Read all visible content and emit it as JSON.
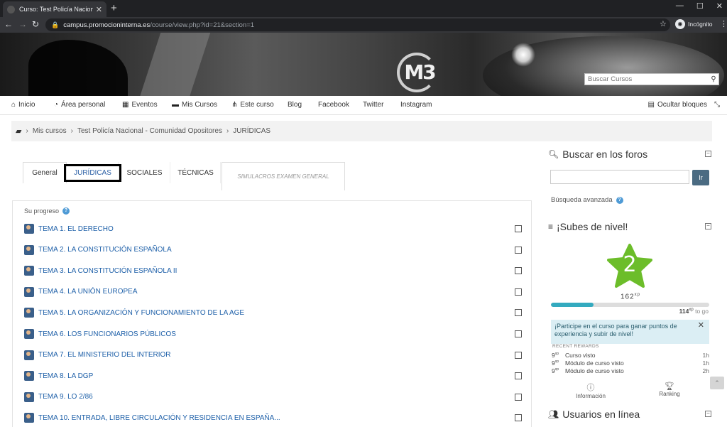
{
  "browser": {
    "tab_title": "Curso: Test Policía Nacional - Co",
    "url_host": "campus.promocioninterna.es",
    "url_path": "/course/view.php?id=21&section=1",
    "incognito_label": "Incógnito"
  },
  "banner": {
    "logo_text": "M3",
    "search_placeholder": "Buscar Cursos"
  },
  "nav": {
    "items": [
      {
        "label": "Inicio",
        "icon": "home-icon"
      },
      {
        "label": "Área personal",
        "icon": "dashboard-icon"
      },
      {
        "label": "Eventos",
        "icon": "calendar-icon"
      },
      {
        "label": "Mis Cursos",
        "icon": "briefcase-icon"
      },
      {
        "label": "Este curso",
        "icon": "sitemap-icon"
      },
      {
        "label": "Blog",
        "icon": ""
      },
      {
        "label": "Facebook",
        "icon": ""
      },
      {
        "label": "Twitter",
        "icon": ""
      },
      {
        "label": "Instagram",
        "icon": ""
      }
    ],
    "hide_blocks": "Ocultar bloques"
  },
  "breadcrumb": [
    "Mis cursos",
    "Test Policía Nacional - Comunidad Opositores",
    "JURÍDICAS"
  ],
  "tabs": [
    "General",
    "JURÍDICAS",
    "SOCIALES",
    "TÉCNICAS",
    "SIMULACROS EXAMEN GENERAL"
  ],
  "progress_label": "Su progreso",
  "topics": [
    "TEMA 1. EL DERECHO",
    "TEMA 2. LA CONSTITUCIÓN ESPAÑOLA",
    "TEMA 3. LA CONSTITUCIÓN ESPAÑOLA II",
    "TEMA 4. LA UNIÓN EUROPEA",
    "TEMA 5. LA ORGANIZACIÓN Y FUNCIONAMIENTO DE LA AGE",
    "TEMA 6. LOS FUNCIONARIOS PÚBLICOS",
    "TEMA 7. EL MINISTERIO DEL INTERIOR",
    "TEMA 8. LA DGP",
    "TEMA 9. LO 2/86",
    "TEMA 10. ENTRADA, LIBRE CIRCULACIÓN Y RESIDENCIA EN ESPAÑA..."
  ],
  "forum_block": {
    "title": "Buscar en los foros",
    "go_label": "Ir",
    "advanced": "Búsqueda avanzada"
  },
  "level_block": {
    "title": "¡Subes de nivel!",
    "level": "2",
    "xp_total": "162",
    "xp_unit": "xp",
    "progress_fraction": 0.27,
    "xp_next": "114",
    "xp_next_suffix": "to go",
    "alert": "¡Participe en el curso para ganar puntos de experiencia y subir de nivel!",
    "recent_title": "RECENT REWARDS",
    "rewards": [
      {
        "points": "9",
        "name": "Curso visto",
        "time": "1h"
      },
      {
        "points": "9",
        "name": "Módulo de curso visto",
        "time": "1h"
      },
      {
        "points": "9",
        "name": "Módulo de curso visto",
        "time": "2h"
      }
    ],
    "info_label": "Información",
    "ranking_label": "Ranking"
  },
  "online_block": {
    "title": "Usuarios en línea"
  },
  "colors": {
    "link": "#1d5fa8",
    "xp_bar": "#33aabf",
    "level_star": "#6cbd2a"
  }
}
